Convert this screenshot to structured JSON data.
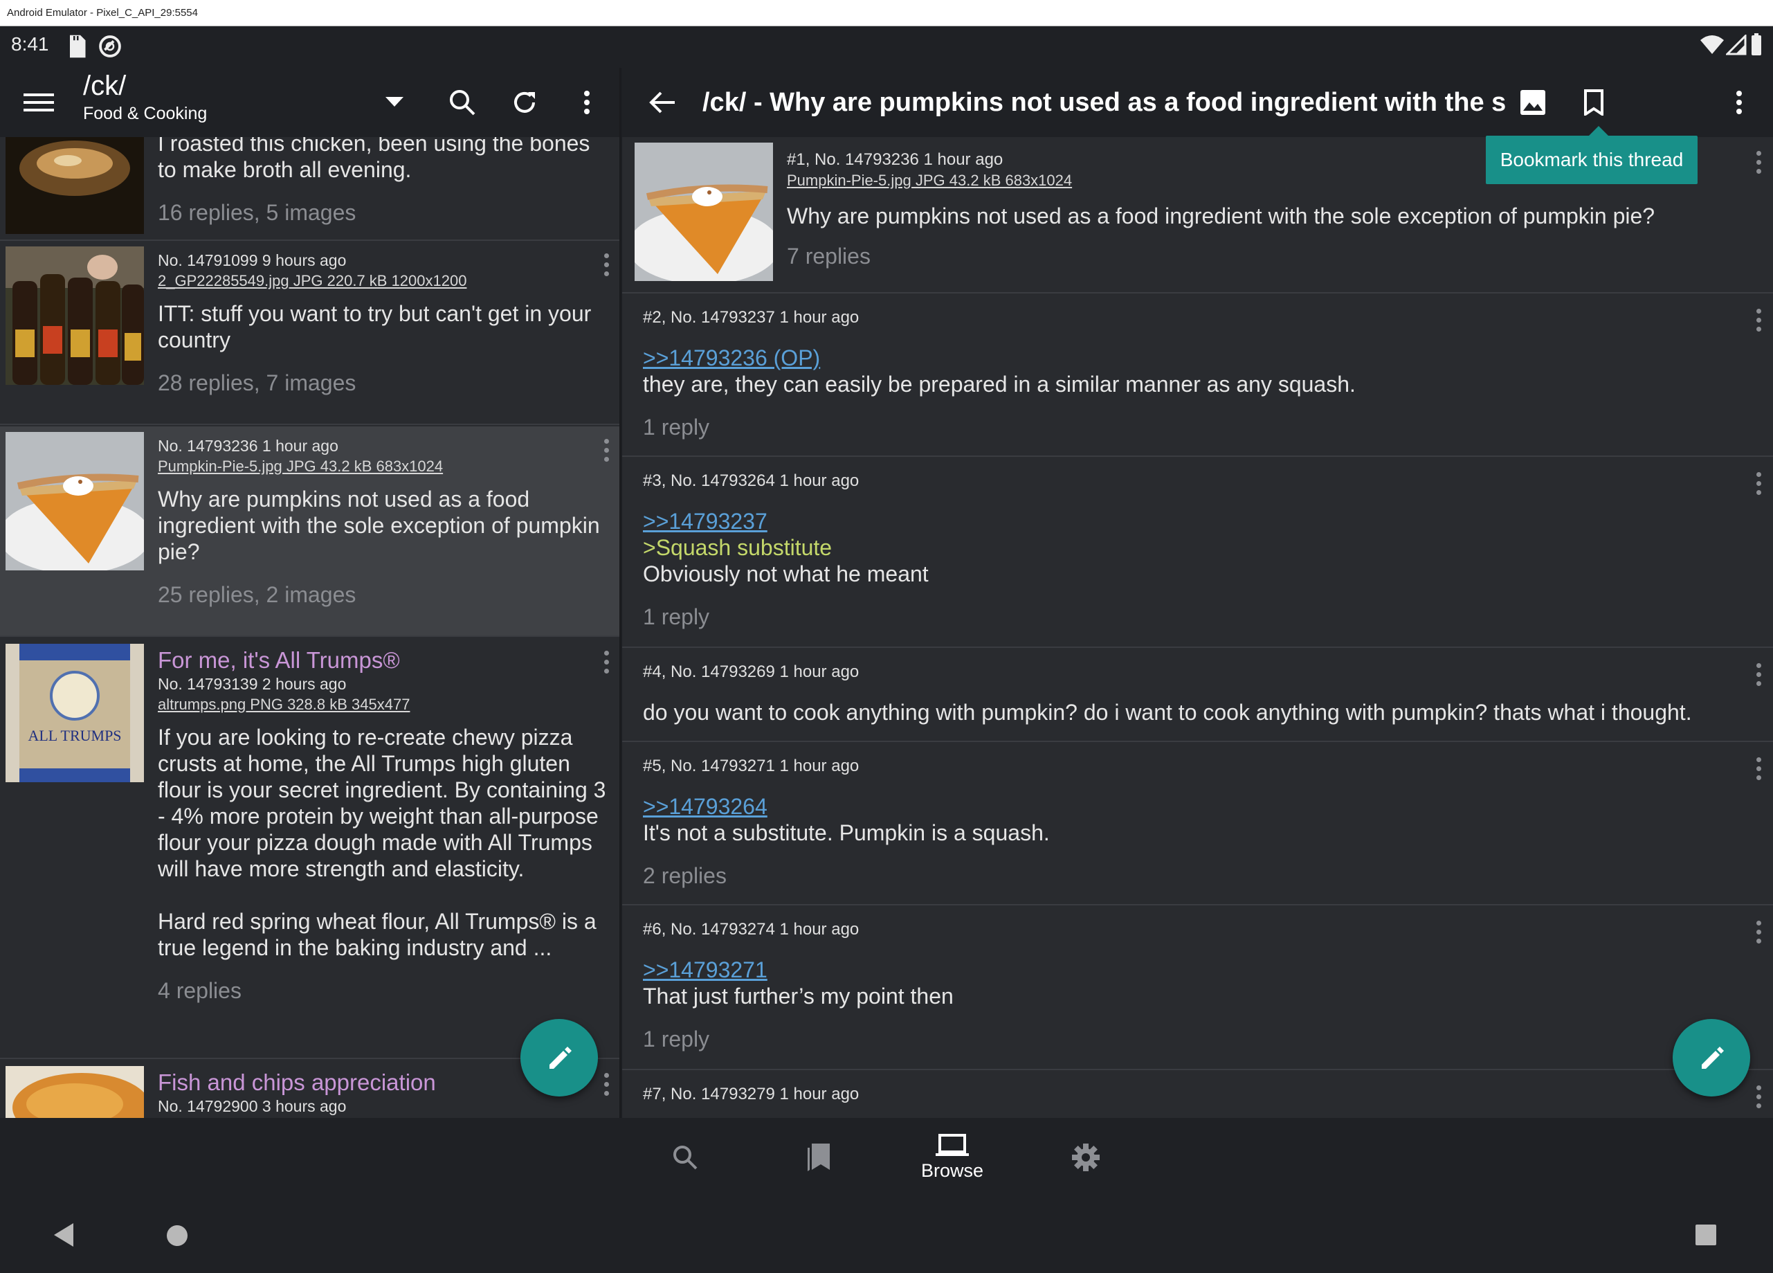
{
  "emulator": {
    "title": "Android Emulator - Pixel_C_API_29:5554"
  },
  "status_bar": {
    "time": "8:41",
    "icons": [
      "sd-card-icon",
      "sync-icon",
      "wifi-icon",
      "signal-icon",
      "battery-icon"
    ]
  },
  "catalog": {
    "board": "/ck/",
    "board_subtitle": "Food & Cooking",
    "items": [
      {
        "text": "I roasted this chicken, been using the bones to make broth all evening.",
        "replies": "16 replies, 5 images"
      },
      {
        "meta": "No. 14791099 9 hours ago",
        "file": "2_GP22285549.jpg JPG 220.7 kB 1200x1200",
        "text": "ITT: stuff you want to try but can't get in your country",
        "replies": "28 replies, 7 images"
      },
      {
        "meta": "No. 14793236 1 hour ago",
        "file": "Pumpkin-Pie-5.jpg JPG 43.2 kB 683x1024",
        "text": "Why are pumpkins not used as a food ingredient with the sole exception of pumpkin pie?",
        "replies": "25 replies, 2 images"
      },
      {
        "subject": "For me, it's All Trumps®",
        "meta": "No. 14793139 2 hours ago",
        "file": "altrumps.png PNG 328.8 kB 345x477",
        "text": "If you are looking to re-create chewy pizza crusts at home, the All Trumps high gluten flour is your secret ingredient. By containing 3 - 4% more protein by weight than all-purpose flour your pizza dough made with All Trumps will have more strength and elasticity.",
        "text2": "Hard red spring wheat flour, All Trumps® is a true legend in the baking industry and ...",
        "replies": "4 replies"
      },
      {
        "subject": "Fish and chips appreciation",
        "meta": "No. 14792900 3 hours ago"
      }
    ]
  },
  "thread": {
    "title": "/ck/ - Why are pumpkins not used as a food ingredient with the sole exception of pumpkin pie?",
    "tooltip": "Bookmark this thread",
    "posts": [
      {
        "meta": "#1, No. 14793236 1 hour ago",
        "file": "Pumpkin-Pie-5.jpg JPG 43.2 kB 683x1024",
        "text": "Why are pumpkins not used as a food ingredient with the sole exception of pumpkin pie?",
        "replies": "7 replies"
      },
      {
        "meta": "#2, No. 14793237 1 hour ago",
        "quote": ">>14793236 (OP)",
        "text": "they are, they can easily be prepared in a similar manner as any squash.",
        "replies": "1 reply"
      },
      {
        "meta": "#3, No. 14793264 1 hour ago",
        "quote": ">>14793237",
        "greentext": ">Squash substitute",
        "text": "Obviously not what he meant",
        "replies": "1 reply"
      },
      {
        "meta": "#4, No. 14793269 1 hour ago",
        "text": "do you want to cook anything with pumpkin? do i want to cook anything with pumpkin? thats what i thought."
      },
      {
        "meta": "#5, No. 14793271 1 hour ago",
        "quote": ">>14793264",
        "text": "It's not a substitute. Pumpkin is a squash.",
        "replies": "2 replies"
      },
      {
        "meta": "#6, No. 14793274 1 hour ago",
        "quote": ">>14793271",
        "text": "That just further’s my point then",
        "replies": "1 reply"
      },
      {
        "meta": "#7, No. 14793279 1 hour ago"
      }
    ]
  },
  "bottom_nav": {
    "items": [
      {
        "icon": "search-icon"
      },
      {
        "icon": "bookmarks-icon"
      },
      {
        "icon": "laptop-icon",
        "label": "Browse"
      },
      {
        "icon": "settings-icon"
      }
    ]
  },
  "colors": {
    "accent": "#189089",
    "background": "#292b2f",
    "toolbar": "#1f2125",
    "subject": "#c996d7",
    "quote_link": "#5aa0d8",
    "greentext": "#c4d86a"
  }
}
